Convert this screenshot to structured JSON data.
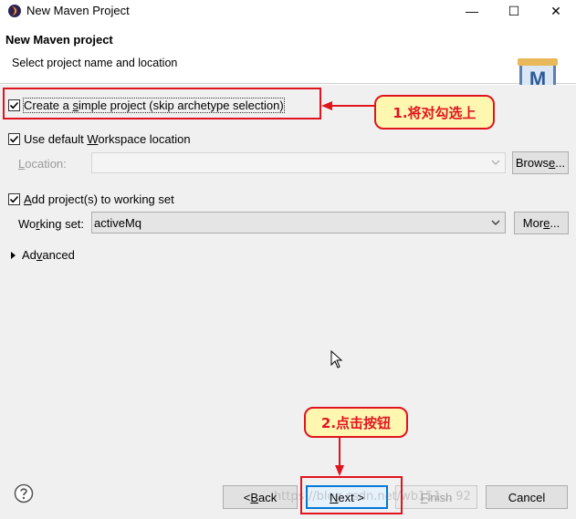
{
  "window": {
    "title": "New Maven Project",
    "minimize_glyph": "—",
    "maximize_glyph": "☐",
    "close_glyph": "✕"
  },
  "header": {
    "title": "New Maven project",
    "description": "Select project name and location",
    "logo_letter": "M"
  },
  "options": {
    "simple_project": {
      "pre": "Create a ",
      "mnemonic": "s",
      "post": "imple project (skip archetype selection)",
      "checked": true
    },
    "default_workspace": {
      "pre": "Use default ",
      "mnemonic": "W",
      "post": "orkspace location",
      "checked": true
    },
    "location": {
      "mnemonic": "L",
      "post": "ocation:",
      "value": ""
    },
    "browse_button": {
      "pre": "Brows",
      "mnemonic": "e",
      "post": "..."
    },
    "add_working_set": {
      "mnemonic": "A",
      "post": "dd project(s) to working set",
      "checked": true
    },
    "working_set": {
      "pre": "Wo",
      "mnemonic": "r",
      "post": "king set:",
      "value": "activeMq"
    },
    "more_button": {
      "pre": "Mor",
      "mnemonic": "e",
      "post": "..."
    },
    "advanced": {
      "pre": "Ad",
      "mnemonic": "v",
      "post": "anced"
    }
  },
  "footer": {
    "back_button": {
      "pre": "< ",
      "mnemonic": "B",
      "post": "ack"
    },
    "next_button": {
      "mnemonic": "N",
      "post": "ext >"
    },
    "finish_button": {
      "mnemonic": "F",
      "post": "inish"
    },
    "cancel_label": "Cancel",
    "watermark": "https://blog.csdn.net/wb151... 92"
  },
  "annotations": {
    "step1": "1.将对勾选上",
    "step2": "2.点击按钮",
    "color": "#e0141e",
    "callout_bg": "#fff6b0"
  },
  "colors": {
    "primary_border": "#0078d7",
    "panel_bg": "#f0f0f0"
  }
}
